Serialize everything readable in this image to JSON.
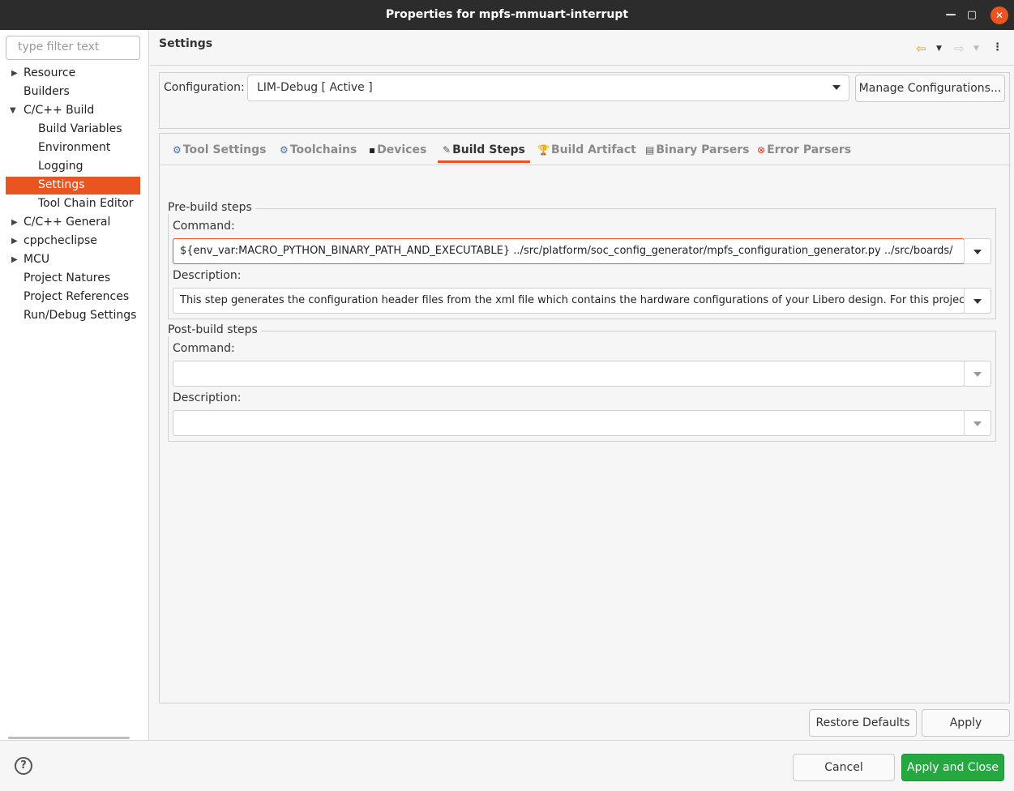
{
  "window": {
    "title": "Properties for mpfs-mmuart-interrupt",
    "min_icon": "minimize-icon",
    "max_icon": "maximize-icon",
    "close_icon": "close-icon"
  },
  "sidebar": {
    "filter_placeholder": "type filter text",
    "items": [
      {
        "label": "Resource",
        "expander": "▶"
      },
      {
        "label": "Builders",
        "expander": ""
      },
      {
        "label": "C/C++ Build",
        "expander": "▼"
      },
      {
        "label": "Build Variables",
        "expander": ""
      },
      {
        "label": "Environment",
        "expander": ""
      },
      {
        "label": "Logging",
        "expander": ""
      },
      {
        "label": "Settings",
        "expander": ""
      },
      {
        "label": "Tool Chain Editor",
        "expander": ""
      },
      {
        "label": "C/C++ General",
        "expander": "▶"
      },
      {
        "label": "cppcheclipse",
        "expander": "▶"
      },
      {
        "label": "MCU",
        "expander": "▶"
      },
      {
        "label": "Project Natures",
        "expander": ""
      },
      {
        "label": "Project References",
        "expander": ""
      },
      {
        "label": "Run/Debug Settings",
        "expander": ""
      }
    ],
    "selected": "Settings"
  },
  "header": {
    "title": "Settings"
  },
  "config": {
    "label": "Configuration:",
    "value": "LIM-Debug  [ Active ]",
    "manage_button": "Manage Configurations..."
  },
  "tabs": [
    {
      "label": "Tool Settings",
      "icon": "⚙"
    },
    {
      "label": "Toolchains",
      "icon": "⚙"
    },
    {
      "label": "Devices",
      "icon": "▪"
    },
    {
      "label": "Build Steps",
      "icon": "✎"
    },
    {
      "label": "Build Artifact",
      "icon": "🏆"
    },
    {
      "label": "Binary Parsers",
      "icon": "▤"
    },
    {
      "label": "Error Parsers",
      "icon": "⊗"
    }
  ],
  "active_tab": "Build Steps",
  "prebuild": {
    "title": "Pre-build steps",
    "command_label": "Command:",
    "command_value": "${env_var:MACRO_PYTHON_BINARY_PATH_AND_EXECUTABLE} ../src/platform/soc_config_generator/mpfs_configuration_generator.py ../src/boards/",
    "description_label": "Description:",
    "description_value": "This step generates the configuration header files from the xml file which contains the hardware configurations of your Libero design. For this project"
  },
  "postbuild": {
    "title": "Post-build steps",
    "command_label": "Command:",
    "command_value": "",
    "description_label": "Description:",
    "description_value": ""
  },
  "buttons": {
    "restore_defaults": "Restore Defaults",
    "apply": "Apply",
    "cancel": "Cancel",
    "apply_and_close": "Apply and Close",
    "help": "?"
  },
  "colors": {
    "accent": "#e95420",
    "primary_button": "#26a841",
    "titlebar": "#2c2c2c"
  }
}
